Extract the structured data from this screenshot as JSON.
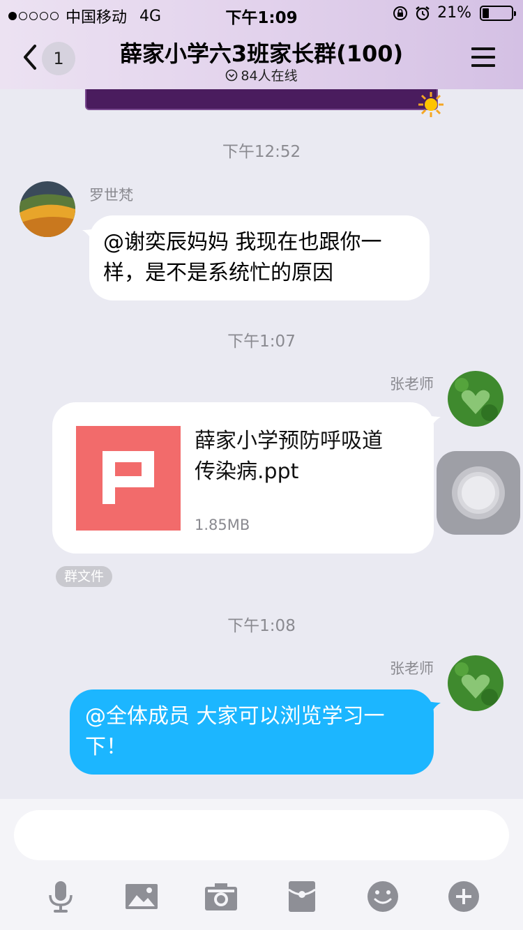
{
  "status_bar": {
    "carrier": "中国移动",
    "network": "4G",
    "time": "下午1:09",
    "battery_percent": "21%",
    "battery_level": 0.21,
    "signal_bars_filled": 1,
    "signal_bars_total": 5,
    "icons": [
      "rotation-lock-icon",
      "alarm-icon",
      "battery-icon"
    ]
  },
  "nav": {
    "back_count": "1",
    "title": "薛家小学六3班家长群(100)",
    "online_status": "84人在线",
    "icons": [
      "back-chevron-icon",
      "online-chevron-icon",
      "menu-icon"
    ]
  },
  "messages": [
    {
      "timestamp": "下午12:52",
      "sender": "罗世梵",
      "direction": "incoming",
      "text_lines": [
        "@谢奕辰妈妈 我现在也跟你一",
        "样，是不是系统忙的原因"
      ]
    },
    {
      "timestamp": "下午1:07",
      "sender": "张老师",
      "direction": "outgoing",
      "type": "file",
      "file": {
        "name_lines": [
          "薛家小学预防呼吸道",
          "传染病.ppt"
        ],
        "size": "1.85MB",
        "icon": "ppt-file-icon",
        "tag": "群文件"
      }
    },
    {
      "timestamp": "下午1:08",
      "sender": "张老师",
      "direction": "outgoing",
      "text_lines": [
        "@全体成员 大家可以浏览学习一",
        "下！"
      ]
    }
  ],
  "colors": {
    "background": "#eaeaf2",
    "header": "#e2d2ec",
    "outgoing_bubble": "#1cb6ff",
    "incoming_bubble": "#ffffff",
    "ppt_icon": "#f26b6b"
  },
  "input_toolbar": [
    "microphone-icon",
    "image-icon",
    "camera-icon",
    "red-packet-icon",
    "emoji-icon",
    "plus-icon"
  ]
}
